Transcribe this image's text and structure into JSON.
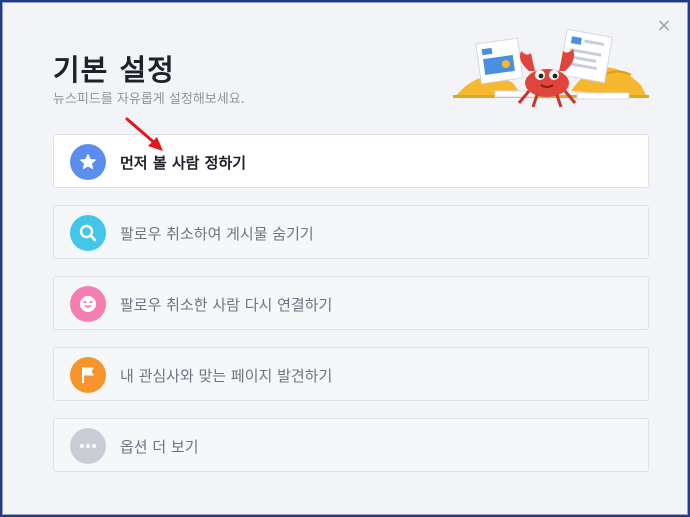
{
  "dialog": {
    "title": "기본 설정",
    "subtitle": "뉴스피드를 자유롭게 설정해보세요.",
    "close_label": "×"
  },
  "options": [
    {
      "label": "먼저 볼 사람 정하기",
      "icon": "star-icon",
      "color": "#5b8def",
      "active": true
    },
    {
      "label": "팔로우 취소하여 게시물 숨기기",
      "icon": "search-icon",
      "color": "#43c6e8",
      "active": false
    },
    {
      "label": "팔로우 취소한 사람 다시 연결하기",
      "icon": "smiley-icon",
      "color": "#f57fb1",
      "active": false
    },
    {
      "label": "내 관심사와 맞는 페이지 발견하기",
      "icon": "flag-icon",
      "color": "#f5952b",
      "active": false
    },
    {
      "label": "옵션 더 보기",
      "icon": "more-dots-icon",
      "color": "#c8ccd4",
      "active": false
    }
  ],
  "colors": {
    "arrow": "#e3161b",
    "background": "#f3f4f7"
  }
}
